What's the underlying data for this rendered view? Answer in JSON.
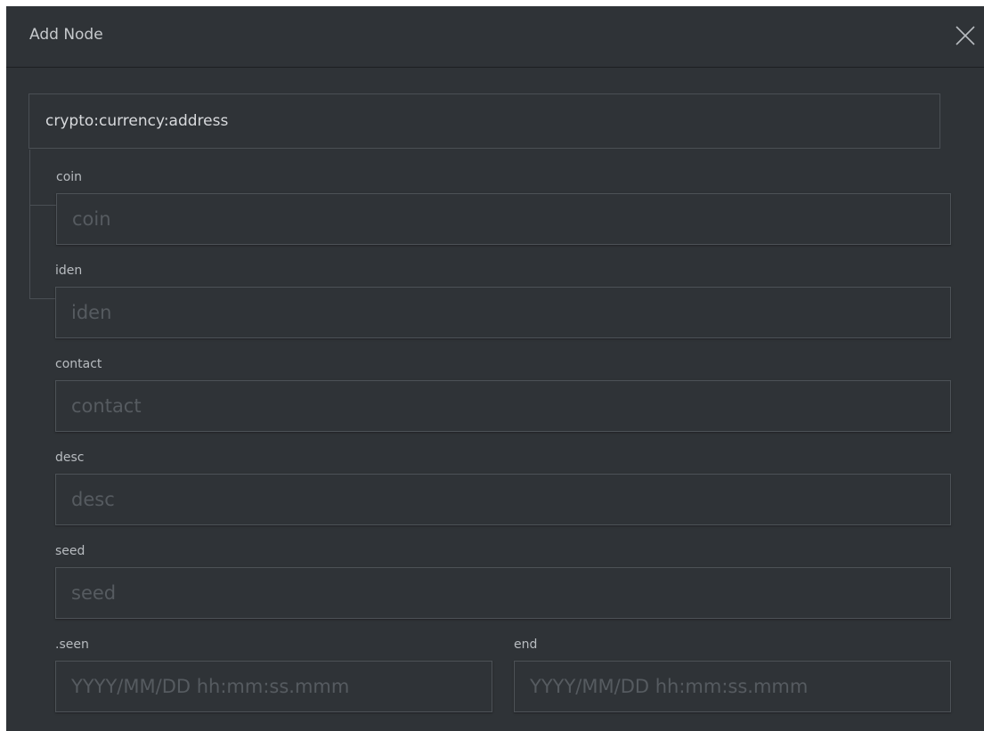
{
  "dialog": {
    "title": "Add Node",
    "form_type": "crypto:currency:address"
  },
  "fields": {
    "coin": {
      "label": "coin",
      "placeholder": "coin",
      "value": ""
    },
    "iden": {
      "label": "iden",
      "placeholder": "iden",
      "value": ""
    },
    "contact": {
      "label": "contact",
      "placeholder": "contact",
      "value": ""
    },
    "desc": {
      "label": "desc",
      "placeholder": "desc",
      "value": ""
    },
    "seed": {
      "label": "seed",
      "placeholder": "seed",
      "value": ""
    },
    "seen": {
      "label": ".seen",
      "placeholder": "YYYY/MM/DD hh:mm:ss.mmm",
      "value": ""
    },
    "end": {
      "label": "end",
      "placeholder": "YYYY/MM/DD hh:mm:ss.mmm",
      "value": ""
    }
  },
  "icons": {
    "close": "close-icon"
  },
  "colors": {
    "background": "#2f3337",
    "border": "#4d5257",
    "text": "#d8dadd",
    "placeholder": "#565b60"
  }
}
